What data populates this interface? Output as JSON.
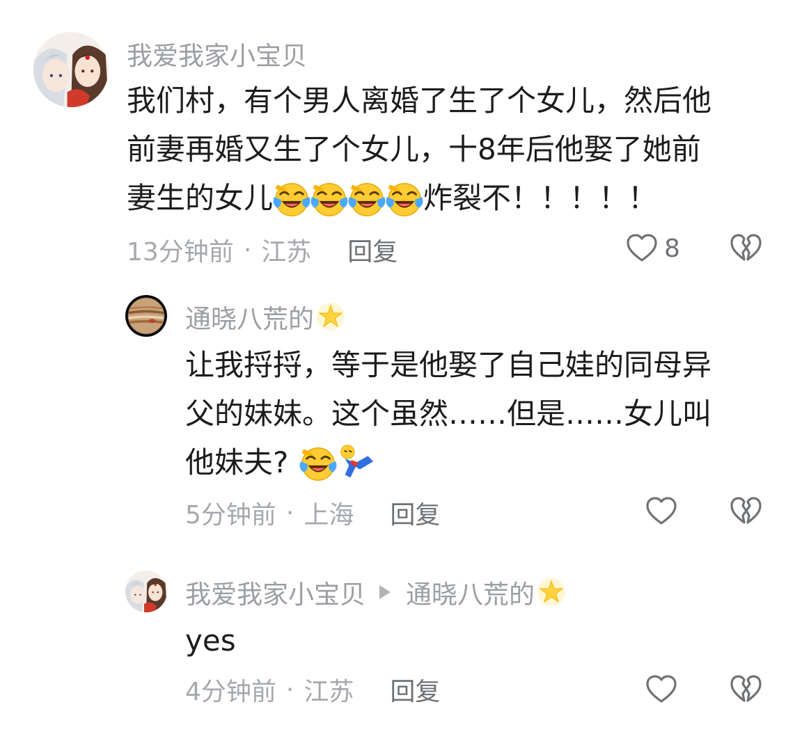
{
  "comments": [
    {
      "username": "我爱我家小宝贝",
      "text_lines": [
        "我们村，有个男人离婚了生了个女儿，然后他",
        "前妻再婚又生了个女儿，十8年后他娶了她前"
      ],
      "line3_start": "妻生的女儿",
      "line3_end": "炸裂不！！！！！",
      "emoji": "laughing-crying-emoji",
      "time": "13分钟前",
      "location": "江苏",
      "separator": "·",
      "reply_label": "回复",
      "like_count": "8"
    },
    {
      "username": "通晓八荒的",
      "text_lines": [
        "让我捋捋，等于是他娶了自己娃的同母异",
        "父的妹妹。这个虽然……但是……女儿叫"
      ],
      "line3_start": "他妹夫?",
      "time": "5分钟前",
      "location": "上海",
      "separator": "·",
      "reply_label": "回复"
    },
    {
      "username": "我爱我家小宝贝",
      "reply_to": "通晓八荒的",
      "text": "yes",
      "time": "4分钟前",
      "location": "江苏",
      "separator": "·",
      "reply_label": "回复"
    }
  ],
  "icons": {
    "like": "heart-outline-icon",
    "dislike": "broken-heart-icon",
    "badge": "glowing-star-icon"
  },
  "colors": {
    "username": "#9b9ea3",
    "text": "#1c1c1e",
    "meta": "#a5a8ad",
    "reply": "#6e7175",
    "icon": "#6e7175"
  }
}
